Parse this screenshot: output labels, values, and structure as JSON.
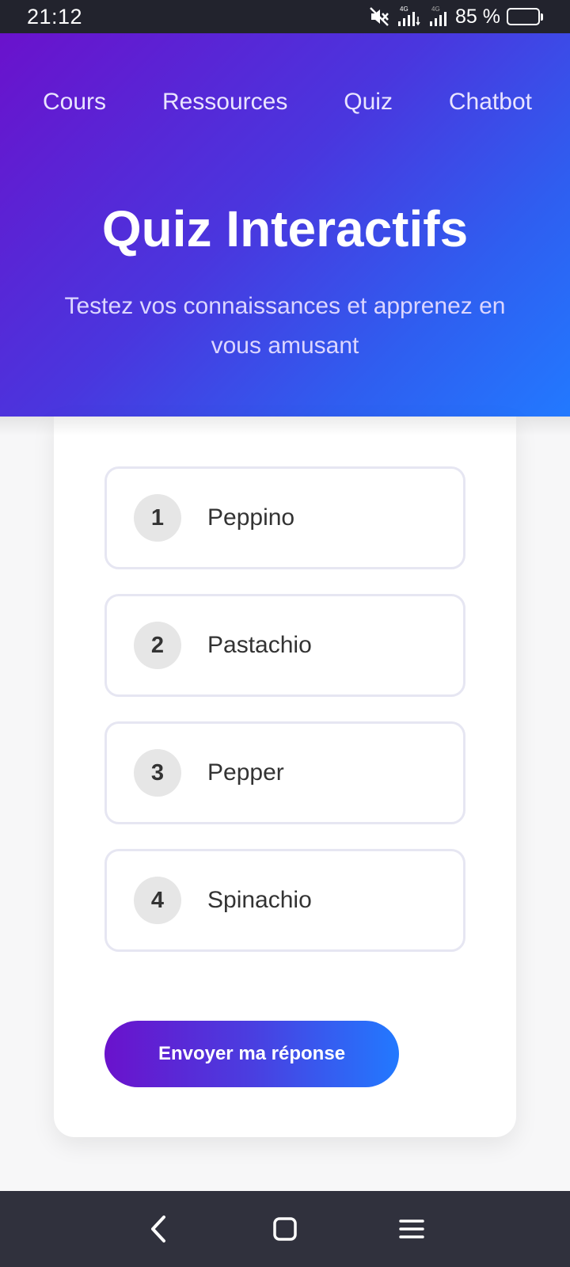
{
  "status_bar": {
    "time": "21:12",
    "network_1": "4G",
    "network_2": "4G",
    "battery_percent": "85 %",
    "battery_level": 0.85
  },
  "nav": {
    "items": [
      {
        "label": "Cours"
      },
      {
        "label": "Ressources"
      },
      {
        "label": "Quiz"
      },
      {
        "label": "Chatbot"
      }
    ]
  },
  "hero": {
    "title": "Quiz Interactifs",
    "subtitle": "Testez vos connaissances et apprenez en vous amusant"
  },
  "quiz": {
    "options": [
      {
        "number": "1",
        "text": "Peppino"
      },
      {
        "number": "2",
        "text": "Pastachio"
      },
      {
        "number": "3",
        "text": "Pepper"
      },
      {
        "number": "4",
        "text": "Spinachio"
      }
    ],
    "submit_label": "Envoyer ma réponse"
  },
  "colors": {
    "gradient_start": "#6a12cc",
    "gradient_end": "#2279ff",
    "status_bar_bg": "#22232d",
    "nav_bar_bg": "#30313d"
  }
}
